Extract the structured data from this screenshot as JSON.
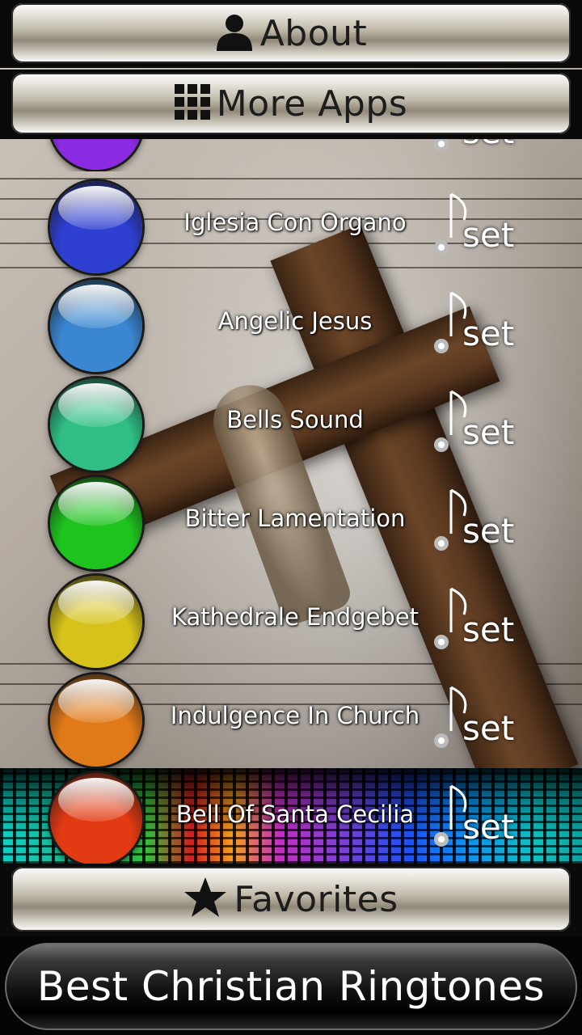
{
  "header": {
    "about_label": "About",
    "more_apps_label": "More Apps"
  },
  "ringtones": [
    {
      "title": "",
      "orb_color": "#8a2be2",
      "set_label": "set"
    },
    {
      "title": "Iglesia Con Organo",
      "orb_color": "#2f3fd0",
      "set_label": "set"
    },
    {
      "title": "Angelic Jesus",
      "orb_color": "#3a86d0",
      "set_label": "set"
    },
    {
      "title": "Bells Sound",
      "orb_color": "#2fbf86",
      "set_label": "set"
    },
    {
      "title": "Bitter Lamentation",
      "orb_color": "#1ec31e",
      "set_label": "set"
    },
    {
      "title": "Kathedrale Endgebet",
      "orb_color": "#d6c21a",
      "set_label": "set"
    },
    {
      "title": "Indulgence In Church",
      "orb_color": "#e07a18",
      "set_label": "set"
    },
    {
      "title": "Bell Of Santa Cecilia",
      "orb_color": "#e23a12",
      "set_label": "set"
    }
  ],
  "favorites_label": "Favorites",
  "app_title": "Best Christian Ringtones",
  "icons": {
    "about": "user-icon",
    "more_apps": "grid-icon",
    "favorites": "star-icon",
    "set": "music-note-gear-icon"
  }
}
